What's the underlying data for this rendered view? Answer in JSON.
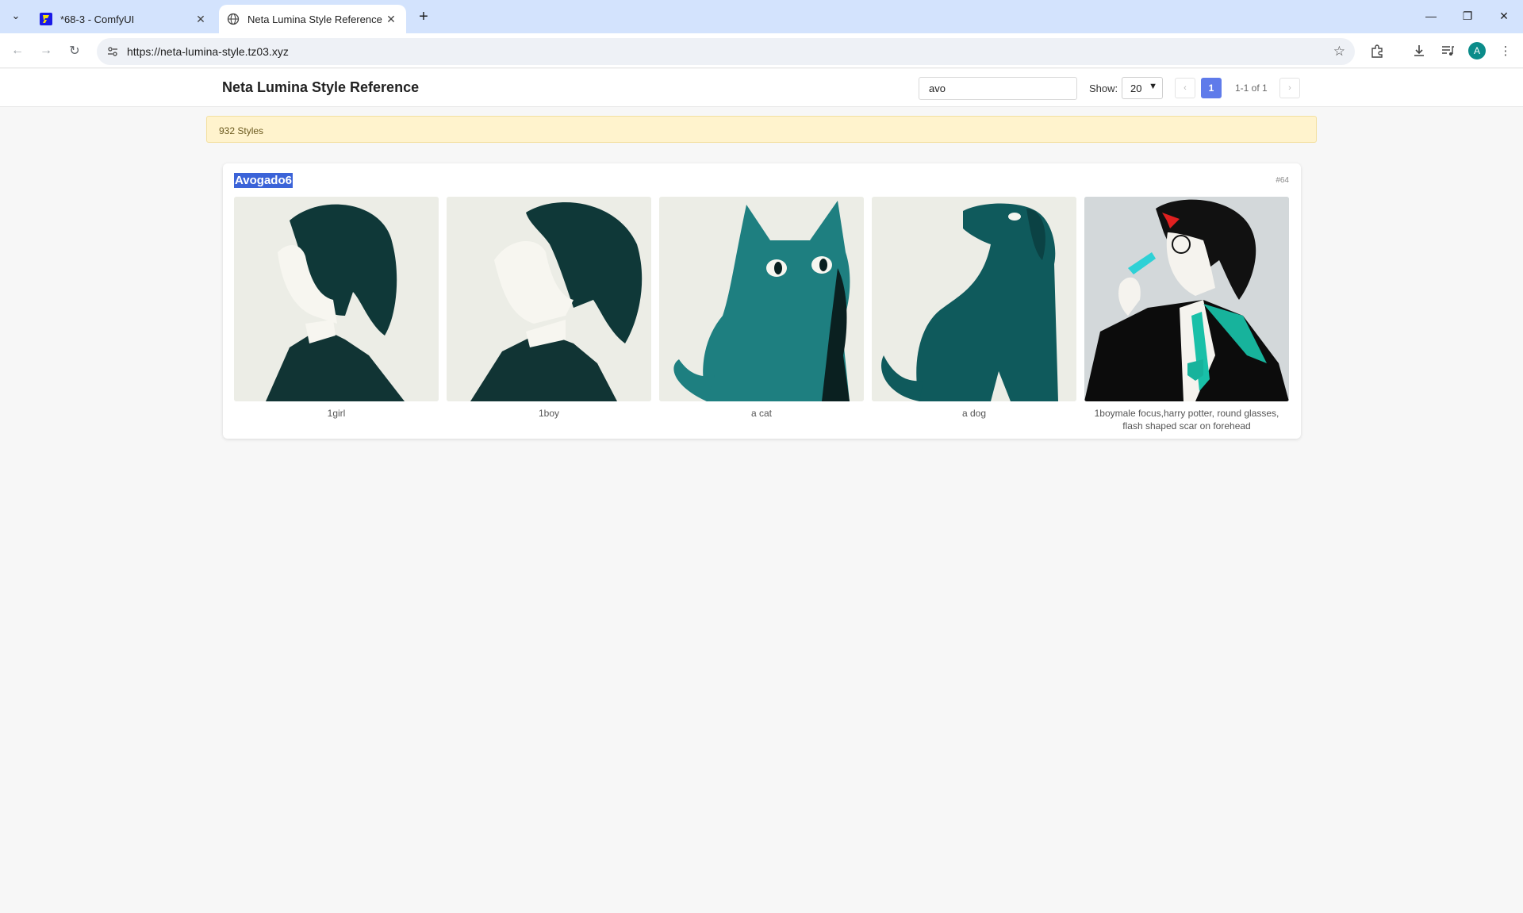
{
  "browser": {
    "tabs": [
      {
        "title": "*68-3 - ComfyUI",
        "active": false
      },
      {
        "title": "Neta Lumina Style Reference",
        "active": true
      }
    ],
    "url": "https://neta-lumina-style.tz03.xyz",
    "profile_initial": "A"
  },
  "header": {
    "title": "Neta Lumina Style Reference",
    "search_value": "avo",
    "show_label": "Show:",
    "show_value": "20",
    "current_page": "1",
    "page_info": "1-1 of 1"
  },
  "count_text": "932 Styles",
  "style": {
    "name": "Avogado6",
    "id": "#64",
    "images": [
      {
        "caption": "1girl",
        "subject": "girl-profile"
      },
      {
        "caption": "1boy",
        "subject": "boy-profile"
      },
      {
        "caption": "a cat",
        "subject": "cat"
      },
      {
        "caption": "a dog",
        "subject": "dog"
      },
      {
        "caption": "1boymale focus,harry potter, round glasses, flash shaped scar on forehead",
        "subject": "wizard-boy"
      }
    ]
  },
  "colors": {
    "accent": "#5f7bea",
    "teal_dark": "#0d3b3b",
    "teal_mid": "#1e7f80",
    "selection": "#3b63d8",
    "banner": "#fff3cd"
  }
}
